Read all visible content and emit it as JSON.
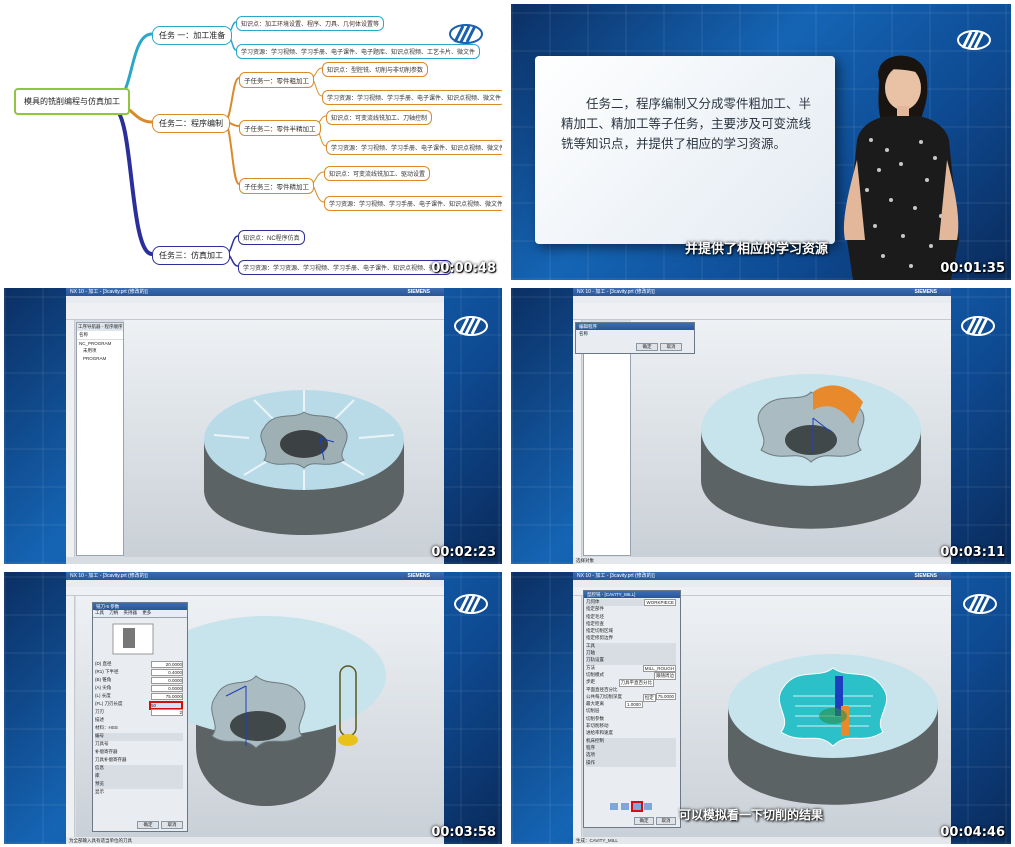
{
  "tile1": {
    "root": "模具的铣削编程与仿真加工",
    "task1": "任务 一：加工准备",
    "task1_nodes": [
      "知识点：加工环境设置、程序、刀具、几何体设置等",
      "学习资源：学习视频、学习手册、电子课件、电子题库、知识点视频、工艺卡片、微文件"
    ],
    "task2": "任务二：程序编制",
    "sub1": "子任务一：零件粗加工",
    "sub1_nodes": [
      "知识点：型腔铣、切削与非切削参数",
      "学习资源：学习视频、学习手册、电子课件、知识点视频、微文件"
    ],
    "sub2": "子任务二：零件半精加工",
    "sub2_nodes": [
      "知识点：可变流线铣加工、刀轴控制",
      "学习资源：学习视频、学习手册、电子课件、知识点视频、微文件"
    ],
    "sub3": "子任务三：零件精加工",
    "sub3_nodes": [
      "知识点：可变流线铣加工、驱动设置",
      "学习资源：学习视频、学习手册、电子课件、知识点视频、微文件"
    ],
    "task3": "任务三：仿真加工",
    "task3_nodes": [
      "知识点：NC程序仿真",
      "学习资源：学习资源、学习视频、学习手册、电子课件、知识点视频、微文件"
    ],
    "timestamp": "00:00:48"
  },
  "tile2": {
    "card_text": "任务二，程序编制又分成零件粗加工、半精加工、精加工等子任务，主要涉及可变流线铣等知识点，并提供了相应的学习资源。",
    "subtitle": "并提供了相应的学习资源",
    "timestamp": "00:01:35"
  },
  "tile3": {
    "title": "NX 10 - 加工 - [3cavity.prt (修改的)]",
    "brand": "SIEMENS",
    "nav_header": "工序导航器 - 程序顺序",
    "nav_items": [
      "名称",
      "NC_PROGRAM",
      "未用项",
      "PROGRAM"
    ],
    "timestamp": "00:02:23"
  },
  "tile4": {
    "title": "NX 10 - 加工 - [3cavity.prt (修改的)]",
    "brand": "SIEMENS",
    "dialog_title": "编辑程序",
    "dialog_item": "名称",
    "btn_ok": "确定",
    "btn_cancel": "取消",
    "status": "选择对象",
    "timestamp": "00:03:11"
  },
  "tile5": {
    "title": "NX 10 - 加工 - [3cavity.prt (修改的)]",
    "brand": "SIEMENS",
    "dialog_title": "铣刀-5 参数",
    "tabs": [
      "工具",
      "刀柄",
      "夹持器",
      "更多"
    ],
    "fields": [
      {
        "label": "(D) 直径",
        "value": "20.0000"
      },
      {
        "label": "(R1) 下半径",
        "value": "0.4000"
      },
      {
        "label": "(B) 锥角",
        "value": "0.0000"
      },
      {
        "label": "(A) 尖角",
        "value": "0.0000"
      },
      {
        "label": "(L) 长度",
        "value": "75.0000"
      },
      {
        "label": "(FL) 刀刃长度",
        "value": "50"
      },
      {
        "label": "刀刃",
        "value": "2"
      }
    ],
    "extra_labels": [
      "描述",
      "材料：HSS",
      "编号",
      "刀具号",
      "补偿寄存器",
      "刀具补偿寄存器",
      "信息",
      "库",
      "预览",
      "显示"
    ],
    "btn_ok": "确定",
    "btn_cancel": "取消",
    "status": "为全部输入具有适当单位的刀具",
    "timestamp": "00:03:58"
  },
  "tile6": {
    "title": "NX 10 - 加工 - [3cavity.prt (修改的)]",
    "brand": "SIEMENS",
    "dialog_title": "型腔铣 - [CAVITY_MILL]",
    "sections": [
      "几何体",
      "指定部件",
      "指定毛坯",
      "指定检查",
      "指定切削区域",
      "指定修剪边界",
      "工具",
      "刀轴",
      "刀轨设置",
      "方法",
      "切削模式",
      "步距",
      "平面直径百分比",
      "公共每刀切削深度",
      "最大距离",
      "切削层",
      "切削参数",
      "非切削移动",
      "进给率和速度",
      "机床控制",
      "程序",
      "选项",
      "操作"
    ],
    "values": [
      "WORKPIECE",
      "MILL_ROUGH",
      "跟随周边",
      "刀具平直百分比",
      "75.0000",
      "恒定",
      "1.0000"
    ],
    "btn_ok": "确定",
    "btn_cancel": "取消",
    "subtitle": "可以模拟看一下切削的结果",
    "status": "生成：CAVITY_MILL",
    "timestamp": "00:04:46"
  }
}
